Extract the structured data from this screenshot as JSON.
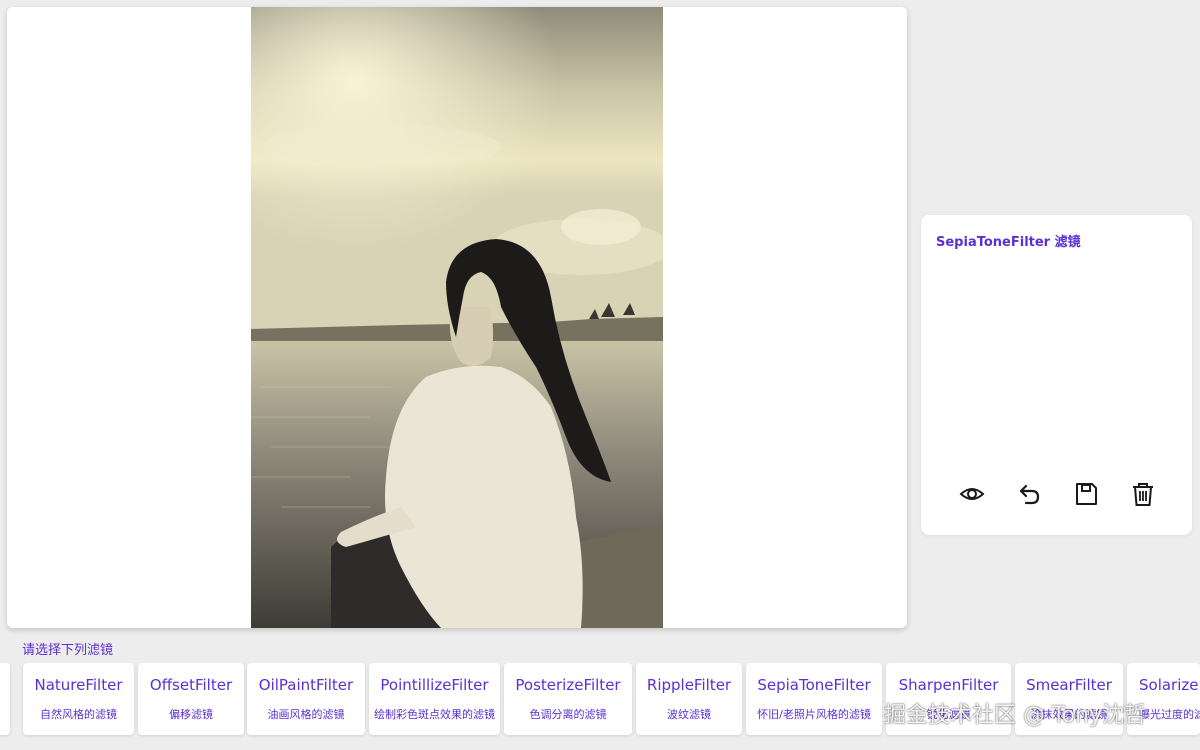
{
  "current_filter": {
    "title": "SepiaToneFilter 滤镜"
  },
  "actions": [
    {
      "icon": "eye-icon",
      "label": ""
    },
    {
      "icon": "undo-icon",
      "label": ""
    },
    {
      "icon": "save-icon",
      "label": ""
    },
    {
      "icon": "trash-icon",
      "label": ""
    }
  ],
  "filter_section": {
    "label": "请选择下列滤镜"
  },
  "filters": [
    {
      "name": "NatureFilter",
      "desc": "自然风格的滤镜"
    },
    {
      "name": "OffsetFilter",
      "desc": "偏移滤镜"
    },
    {
      "name": "OilPaintFilter",
      "desc": "油画风格的滤镜"
    },
    {
      "name": "PointillizeFilter",
      "desc": "绘制彩色斑点效果的滤镜"
    },
    {
      "name": "PosterizeFilter",
      "desc": "色调分离的滤镜"
    },
    {
      "name": "RippleFilter",
      "desc": "波纹滤镜"
    },
    {
      "name": "SepiaToneFilter",
      "desc": "怀旧/老照片风格的滤镜"
    },
    {
      "name": "SharpenFilter",
      "desc": "锐化滤镜"
    },
    {
      "name": "SmearFilter",
      "desc": "涂抹效果的滤镜"
    },
    {
      "name": "SolarizeFilter",
      "desc": "曝光过度的滤镜"
    }
  ],
  "watermark": "掘金技术社区 @ Tony沈哲",
  "colors": {
    "accent": "#5b2fd3",
    "background": "#ededed",
    "card": "#ffffff",
    "icon": "#1a1a1a"
  }
}
